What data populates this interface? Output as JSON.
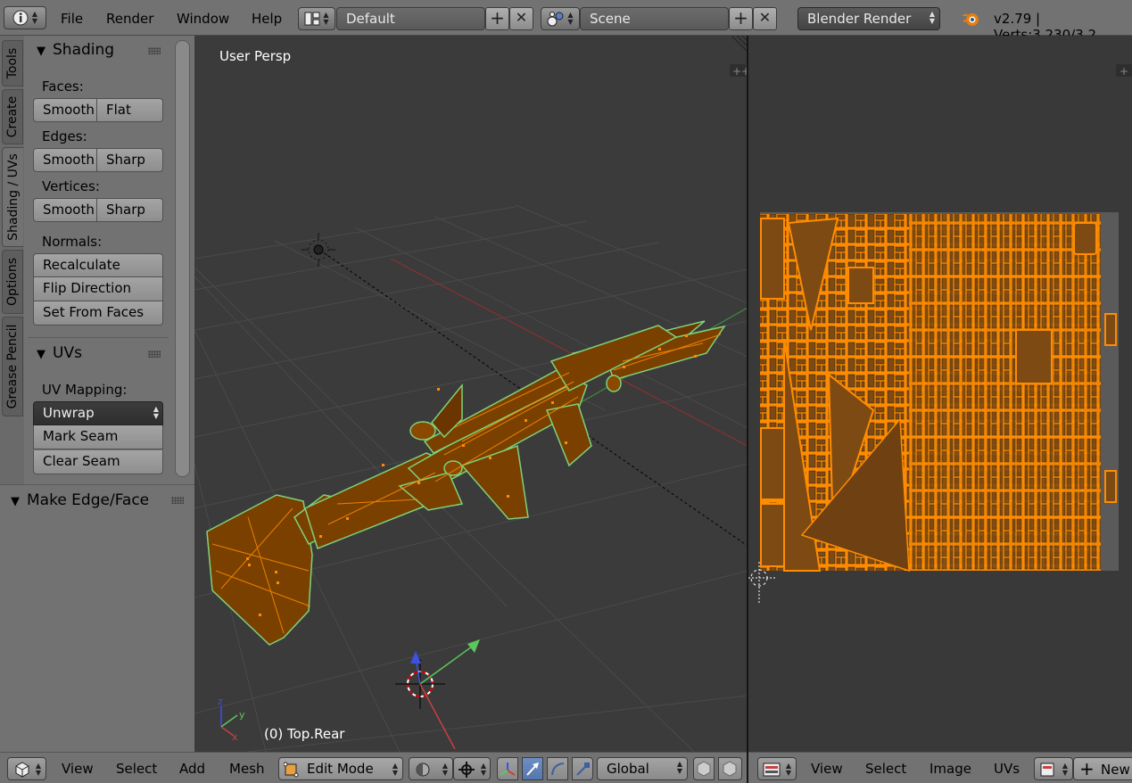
{
  "app": {
    "version_info": "v2.79 | Verts:3,230/3,2",
    "menus": [
      "File",
      "Render",
      "Window",
      "Help"
    ],
    "screen_layout": "Default",
    "scene": "Scene",
    "render_engine": "Blender Render"
  },
  "tool_tabs": [
    "Tools",
    "Create",
    "Shading / UVs",
    "Options",
    "Grease Pencil"
  ],
  "active_tab": "Shading / UVs",
  "shading_panel": {
    "title": "Shading",
    "faces_label": "Faces:",
    "faces_buttons": [
      "Smooth",
      "Flat"
    ],
    "edges_label": "Edges:",
    "edges_buttons": [
      "Smooth",
      "Sharp"
    ],
    "vertices_label": "Vertices:",
    "vertices_buttons": [
      "Smooth",
      "Sharp"
    ],
    "normals_label": "Normals:",
    "normals_buttons": [
      "Recalculate",
      "Flip Direction",
      "Set From Faces"
    ]
  },
  "uvs_panel": {
    "title": "UVs",
    "mapping_label": "UV Mapping:",
    "unwrap_label": "Unwrap",
    "mark_seam": "Mark Seam",
    "clear_seam": "Clear Seam"
  },
  "operator_panel": {
    "title": "Make Edge/Face"
  },
  "viewport": {
    "view_name": "User Persp",
    "object_info": "(0) Top.Rear"
  },
  "viewport_header": {
    "menus": [
      "View",
      "Select",
      "Add",
      "Mesh"
    ],
    "mode": "Edit Mode",
    "orientation": "Global"
  },
  "uv_header": {
    "menus": [
      "View",
      "Select",
      "Image",
      "UVs"
    ],
    "new_label": "New"
  },
  "colors": {
    "header_bg": "#727272",
    "viewport_bg": "#3b3b3b",
    "mesh_orange": "#ff8c00",
    "face_fill": "#7a4000",
    "edge_green": "#7ed27a",
    "axis_red": "#c84040",
    "axis_green": "#5ac85a",
    "axis_blue": "#3c50e6"
  }
}
